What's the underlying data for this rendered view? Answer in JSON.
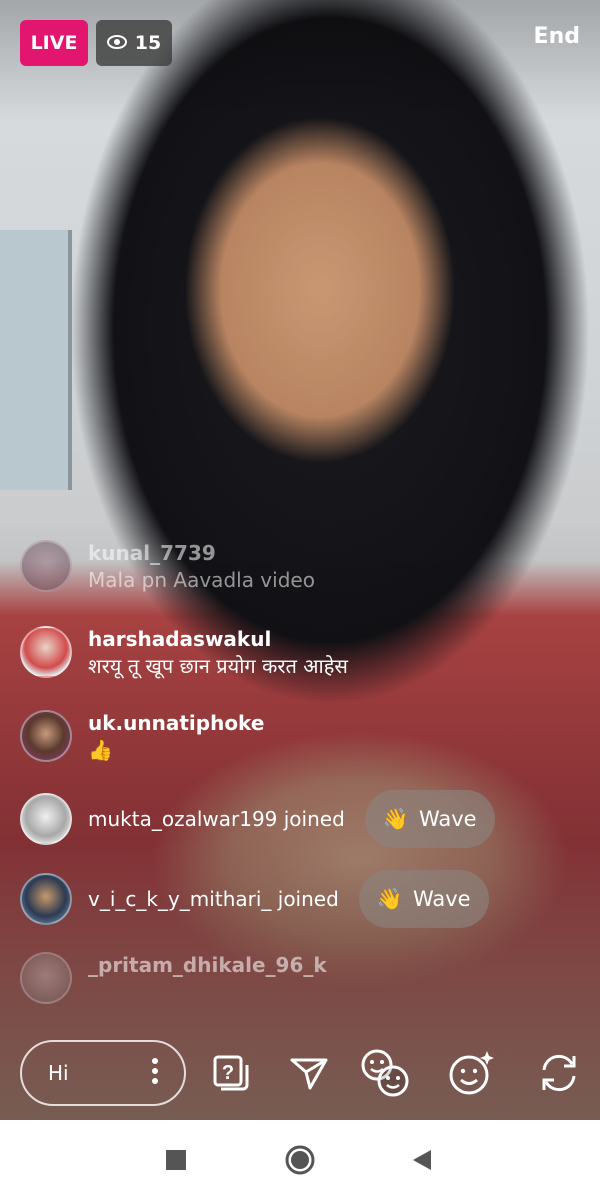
{
  "header": {
    "live_label": "LIVE",
    "viewer_count": "15",
    "end_label": "End"
  },
  "comments": [
    {
      "username": "kunal_7739",
      "message": "Mala pn Aavadla video",
      "avatar_color": "#7d5a6b"
    },
    {
      "username": "harshadaswakul",
      "message": "शरयू तू खूप छान प्रयोग करत आहेस",
      "avatar_color": "#d9d6d2"
    },
    {
      "username": "uk.unnatiphoke",
      "message": "👍",
      "avatar_color": "#6b4a3c"
    }
  ],
  "joins": [
    {
      "text": "mukta_ozalwar199 joined",
      "wave_label": "Wave",
      "avatar_color": "#cfcfcf"
    },
    {
      "text": "v_i_c_k_y_mithari_ joined",
      "wave_label": "Wave",
      "avatar_color": "#4a6a8a"
    }
  ],
  "fading_user": "_pritam_dhikale_96_k",
  "composer": {
    "text": "Hi"
  },
  "icons": [
    "question-sticker-icon",
    "send-icon",
    "face-filter-icon",
    "effects-icon",
    "flip-camera-icon"
  ],
  "colors": {
    "live_badge": "#e2156f",
    "nav_bar": "#ffffff"
  }
}
